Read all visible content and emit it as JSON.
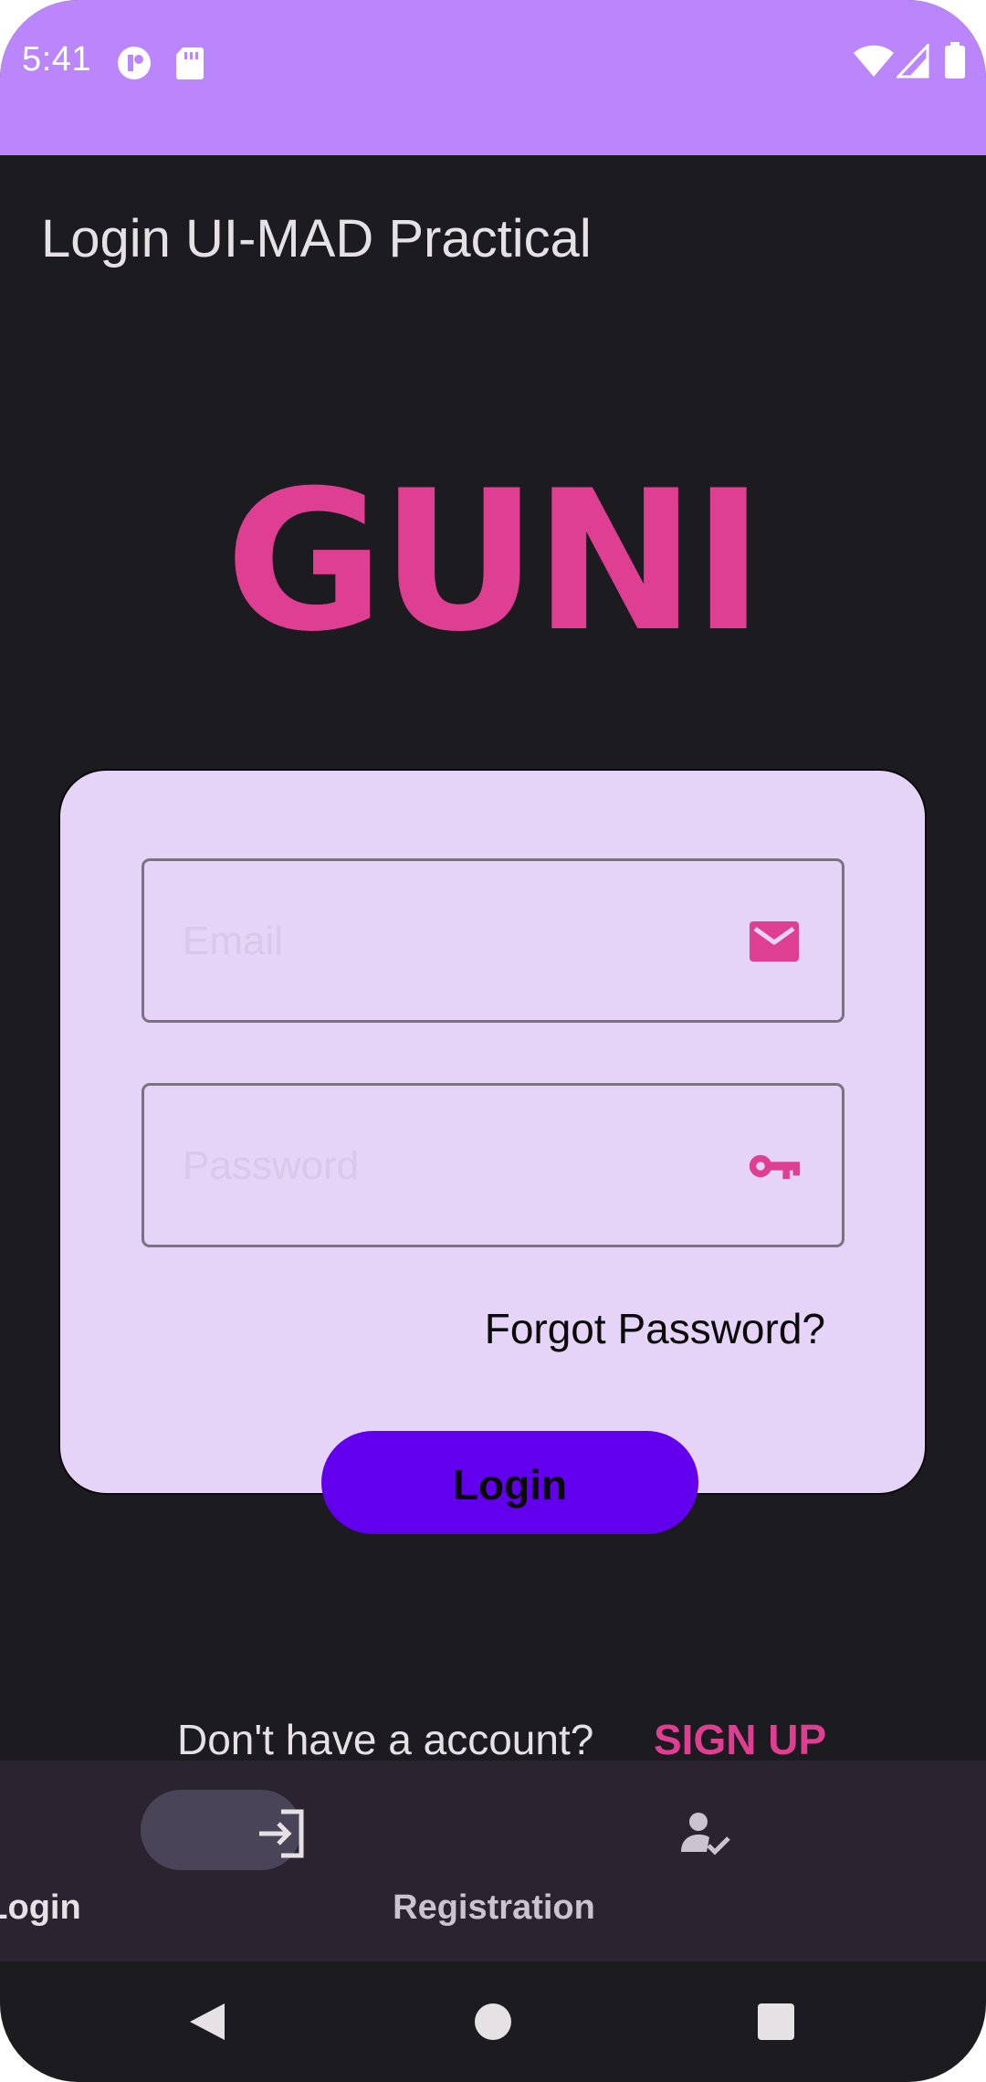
{
  "status_bar": {
    "time": "5:41",
    "icons": [
      "media-icon",
      "sd-card-icon",
      "wifi-icon",
      "signal-icon",
      "battery-icon"
    ]
  },
  "app_bar": {
    "title": "Login UI-MAD Practical"
  },
  "logo": {
    "text": "GUNI",
    "color": "#de3f93"
  },
  "login_form": {
    "email_placeholder": "Email",
    "email_value": "",
    "password_placeholder": "Password",
    "password_value": "",
    "forgot_label": "Forgot Password?",
    "login_label": "Login"
  },
  "signup": {
    "prompt": "Don't have a account?",
    "action_label": "SIGN UP"
  },
  "bottom_nav": {
    "items": [
      {
        "label": "Login",
        "icon": "login-icon",
        "selected": true
      },
      {
        "label": "Registration",
        "icon": "person-check-icon",
        "selected": false
      }
    ]
  },
  "system_nav": {
    "icons": [
      "back-icon",
      "home-icon",
      "recents-icon"
    ]
  },
  "colors": {
    "status_bar": "#bb86fc",
    "background": "#1c1b1f",
    "card": "#e5d3f8",
    "accent": "#de3f93",
    "button": "#6200ee",
    "nav_bar": "#2a2430"
  }
}
